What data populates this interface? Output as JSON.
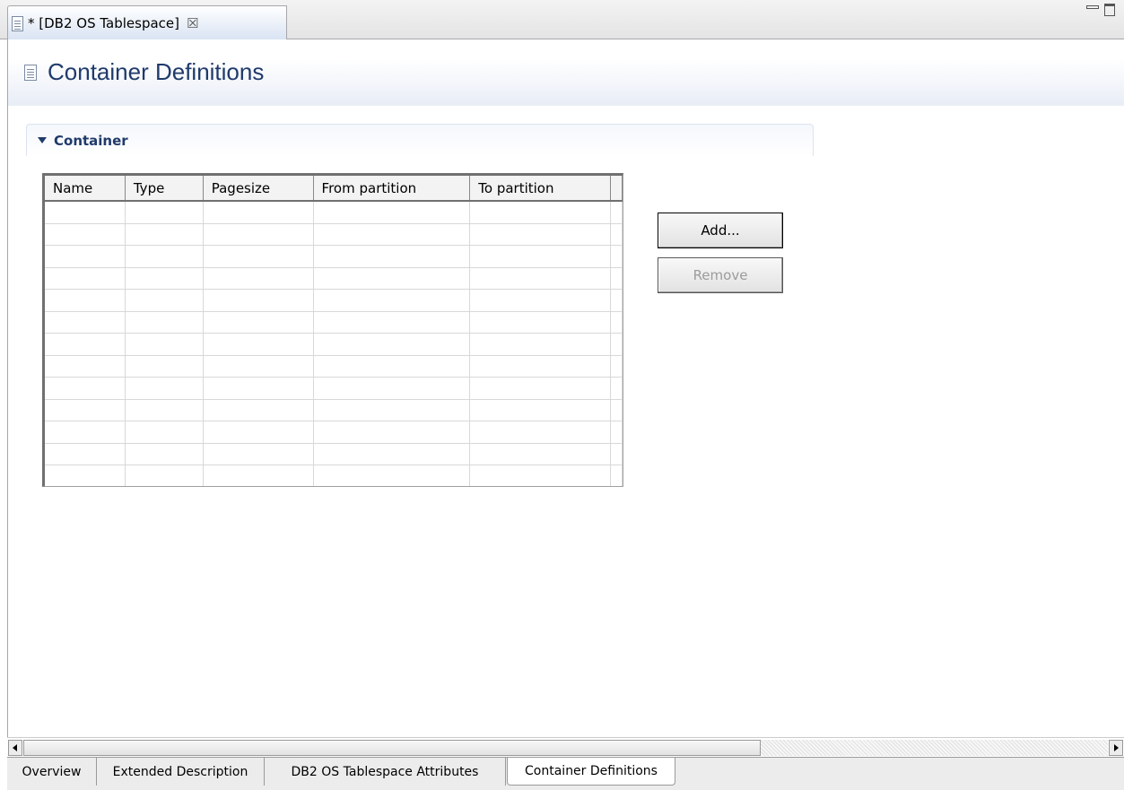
{
  "editor_tab": {
    "title": "* [DB2 OS Tablespace]",
    "close_glyph": "☒"
  },
  "page": {
    "title": "Container Definitions"
  },
  "section": {
    "title": "Container",
    "expanded": true
  },
  "table": {
    "columns": [
      "Name",
      "Type",
      "Pagesize",
      "From partition",
      "To partition"
    ],
    "rows": [],
    "empty_row_count": 13
  },
  "buttons": {
    "add": "Add...",
    "remove": "Remove",
    "remove_enabled": false
  },
  "page_tabs": [
    {
      "label": "Overview",
      "active": false
    },
    {
      "label": "Extended Description",
      "active": false
    },
    {
      "label": "DB2 OS Tablespace Attributes",
      "active": false
    },
    {
      "label": "Container Definitions",
      "active": true
    }
  ]
}
